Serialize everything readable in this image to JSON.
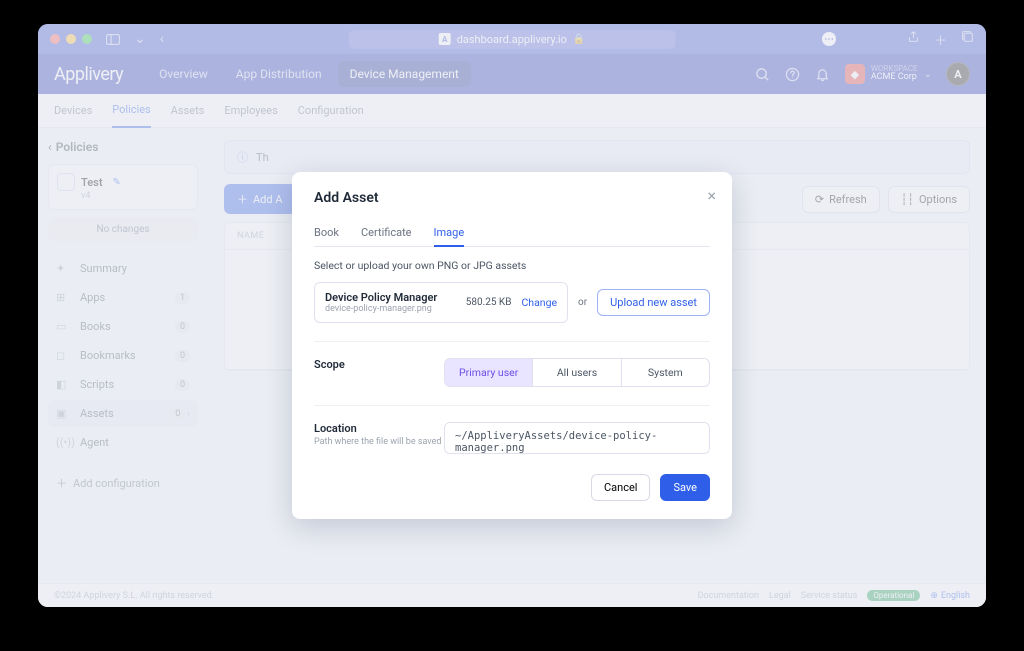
{
  "browser": {
    "url": "dashboard.applivery.io"
  },
  "header": {
    "logo": "Applivery",
    "nav": [
      "Overview",
      "App Distribution",
      "Device Management"
    ],
    "active_nav": 2,
    "workspace_label": "WORKSPACE",
    "workspace_name": "ACME Corp"
  },
  "subnav": {
    "items": [
      "Devices",
      "Policies",
      "Assets",
      "Employees",
      "Configuration"
    ],
    "active": 1
  },
  "sidebar": {
    "back_label": "Policies",
    "policy": {
      "name": "Test",
      "version": "v4"
    },
    "no_changes": "No changes",
    "items": [
      {
        "icon": "sparkle",
        "label": "Summary",
        "badge": ""
      },
      {
        "icon": "grid",
        "label": "Apps",
        "badge": "1"
      },
      {
        "icon": "book",
        "label": "Books",
        "badge": "0"
      },
      {
        "icon": "bookmark",
        "label": "Bookmarks",
        "badge": "0"
      },
      {
        "icon": "code",
        "label": "Scripts",
        "badge": "0"
      },
      {
        "icon": "image",
        "label": "Assets",
        "badge": "0",
        "active": true,
        "chev": true
      },
      {
        "icon": "signal",
        "label": "Agent",
        "badge": ""
      }
    ],
    "add_config": "Add configuration"
  },
  "main": {
    "banner_prefix": "Th",
    "add_button": "Add A",
    "refresh": "Refresh",
    "options": "Options",
    "table_header": "NAME"
  },
  "modal": {
    "title": "Add Asset",
    "tabs": [
      "Book",
      "Certificate",
      "Image"
    ],
    "active_tab": 2,
    "description": "Select or upload your own PNG or JPG assets",
    "asset": {
      "name": "Device Policy Manager",
      "filename": "device-policy-manager.png",
      "size": "580.25 KB",
      "change": "Change"
    },
    "or": "or",
    "upload_new": "Upload new asset",
    "scope_label": "Scope",
    "scope_options": [
      "Primary user",
      "All users",
      "System"
    ],
    "scope_active": 0,
    "location_label": "Location",
    "location_hint": "Path where the file will be saved",
    "location_value": "~/AppliveryAssets/device-policy-manager.png",
    "cancel": "Cancel",
    "save": "Save"
  },
  "footer": {
    "copyright": "©2024 Applivery S.L. All rights reserved.",
    "links": [
      "Documentation",
      "Legal",
      "Service status"
    ],
    "status_pill": "Operational",
    "language": "English"
  }
}
